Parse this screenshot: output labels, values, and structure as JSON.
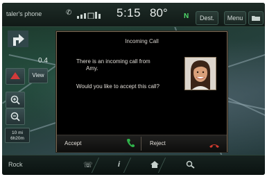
{
  "topbar": {
    "device_label": "taler's phone",
    "time": "5:15",
    "temperature": "80°",
    "nav_indicator": "N",
    "dest_label": "Dest.",
    "menu_label": "Menu"
  },
  "map": {
    "distance_to_turn": "0.4",
    "view_label": "View",
    "scale_line1": "10 mi",
    "scale_line2": "6h20m"
  },
  "dialog": {
    "title": "Incoming Call",
    "message_line1": "There is an incoming call from",
    "message_line2": "Amy.",
    "question": "Would you like to accept this call?",
    "accept_label": "Accept",
    "reject_label": "Reject",
    "accept_color": "#2fb34a",
    "reject_color": "#d23a2f"
  },
  "bottombar": {
    "source_label": "Rock",
    "info_icon_glyph": "i"
  }
}
